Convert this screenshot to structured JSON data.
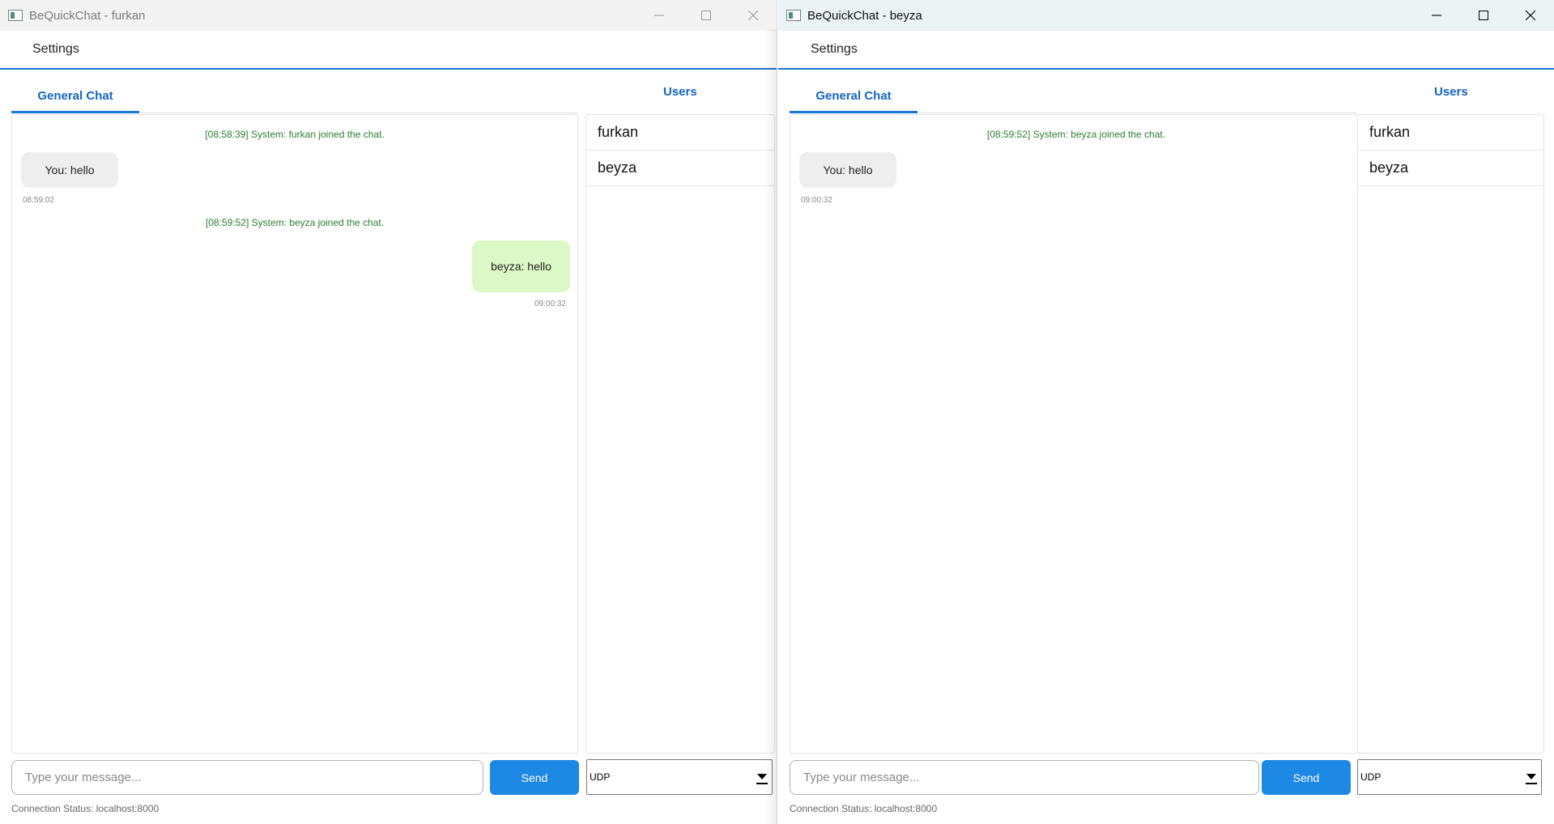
{
  "left_window": {
    "title": "BeQuickChat - furkan",
    "menu": {
      "settings": "Settings"
    },
    "tab_label": "General Chat",
    "users_title": "Users",
    "messages": {
      "sys1": "[08:58:39] System: furkan joined the chat.",
      "own_bubble": "You: hello",
      "own_time": "08:59:02",
      "sys2": "[08:59:52] System: beyza joined the chat.",
      "other_bubble": "beyza: hello",
      "other_time": "09:00:32"
    },
    "users": [
      "furkan",
      "beyza"
    ],
    "input_placeholder": "Type your message...",
    "send_label": "Send",
    "protocol": "UDP",
    "status": "Connection Status: localhost:8000"
  },
  "right_window": {
    "title": "BeQuickChat - beyza",
    "menu": {
      "settings": "Settings"
    },
    "tab_label": "General Chat",
    "users_title": "Users",
    "messages": {
      "sys1": "[08:59:52] System: beyza joined the chat.",
      "own_bubble": "You: hello",
      "own_time": "09:00:32"
    },
    "users": [
      "furkan",
      "beyza"
    ],
    "input_placeholder": "Type your message...",
    "send_label": "Send",
    "protocol": "UDP",
    "status": "Connection Status: localhost:8000"
  },
  "colors": {
    "accent": "#1976d2",
    "system_text": "#2e7d32",
    "incoming_bubble": "#dcf8c6",
    "own_bubble": "#eeeeee",
    "send_button": "#1e88e5"
  },
  "icons": {
    "app": "app-window-icon",
    "minimize": "minimize-icon",
    "maximize": "maximize-icon",
    "close": "close-icon",
    "dropdown": "chevron-down-icon"
  }
}
